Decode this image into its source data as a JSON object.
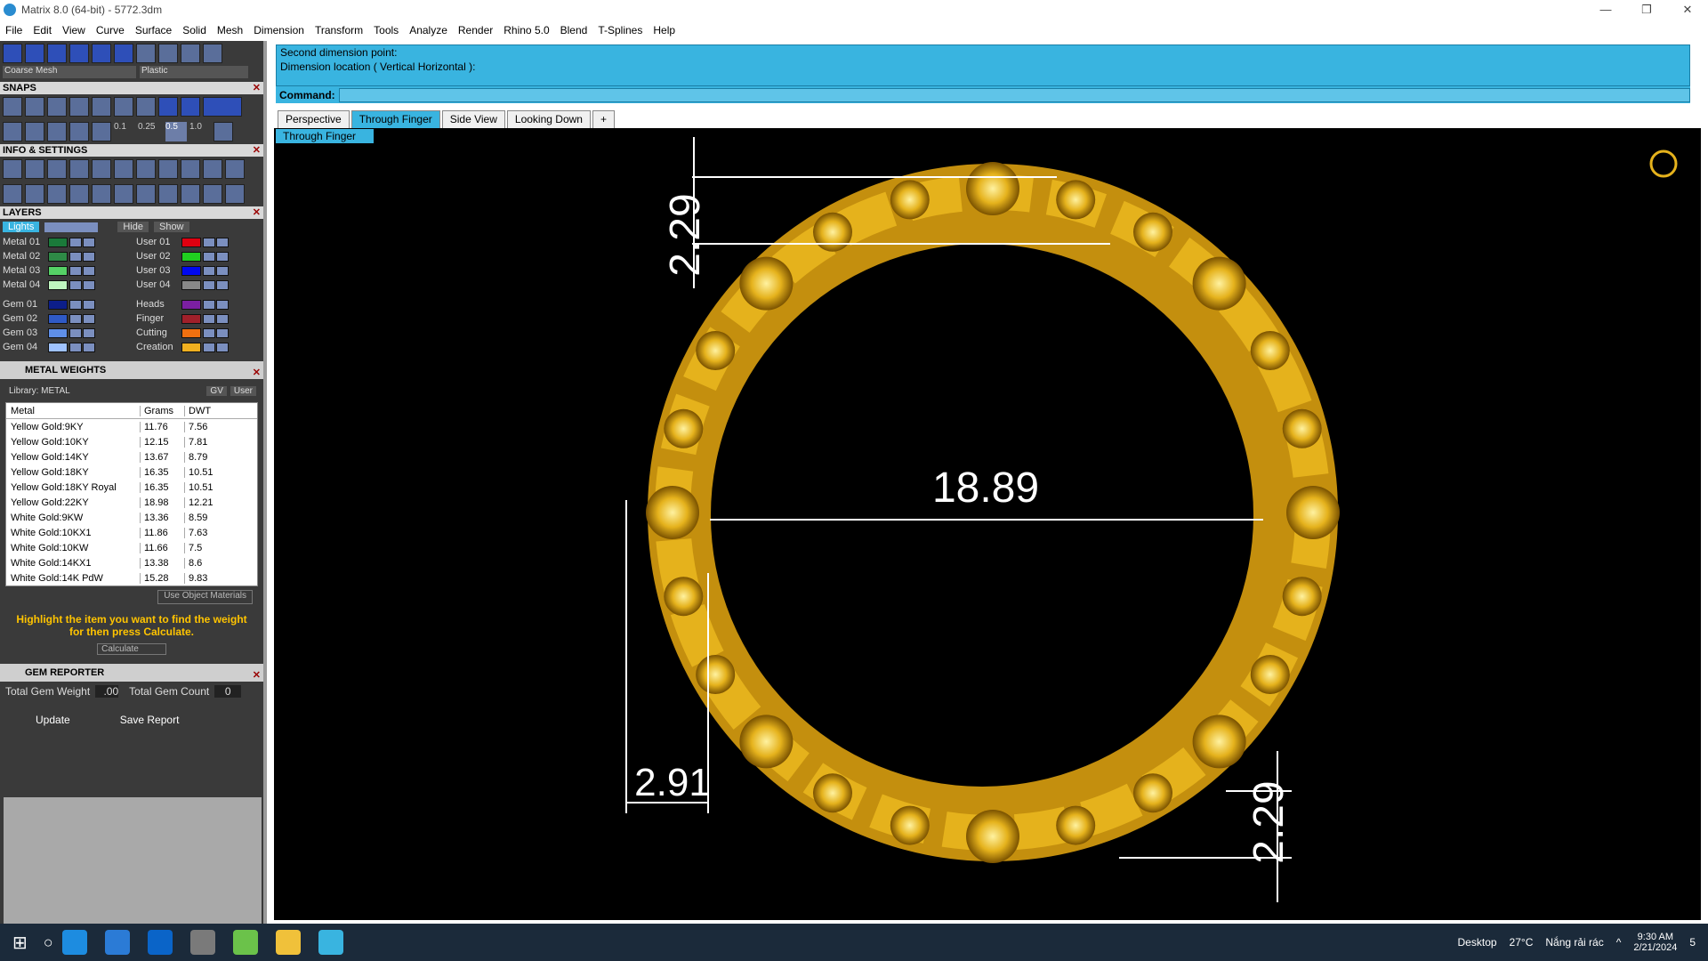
{
  "window": {
    "title": "Matrix 8.0 (64-bit) - 5772.3dm",
    "minimize": "—",
    "maximize": "❐",
    "close": "✕"
  },
  "menubar": [
    "File",
    "Edit",
    "View",
    "Curve",
    "Surface",
    "Solid",
    "Mesh",
    "Dimension",
    "Transform",
    "Tools",
    "Analyze",
    "Render",
    "Rhino 5.0",
    "Blend",
    "T-Splines",
    "Help"
  ],
  "leftpanel": {
    "mesh_dropdown": "Coarse Mesh",
    "material_dropdown": "Plastic",
    "snaps_title": "SNAPS",
    "snap_values": [
      "0.1",
      "0.25",
      "0.5",
      "1.0"
    ],
    "info_title": "INFO & SETTINGS",
    "layers_title": "LAYERS",
    "lights": "Lights",
    "hide": "Hide",
    "show": "Show",
    "layers_left": [
      "Metal 01",
      "Metal 02",
      "Metal 03",
      "Metal 04",
      "Gem 01",
      "Gem 02",
      "Gem 03",
      "Gem 04"
    ],
    "layers_left_colors": [
      "#1a7a3a",
      "#2e8a46",
      "#55d166",
      "#bff5bf",
      "#0c1e8a",
      "#2f5ac6",
      "#5f8fe8",
      "#9fc2ff"
    ],
    "layers_right": [
      "User 01",
      "User 02",
      "User 03",
      "User 04",
      "Heads",
      "Finger",
      "Cutting",
      "Creation"
    ],
    "layers_right_colors": [
      "#e00010",
      "#20d020",
      "#0008f0",
      "#888888",
      "#7b1fa2",
      "#a0202a",
      "#f07010",
      "#f0b020"
    ],
    "metal_weights_title": "METAL WEIGHTS",
    "library_label": "Library: METAL",
    "gv_label": "GV",
    "user_label": "User",
    "table_headers": [
      "Metal",
      "Grams",
      "DWT"
    ],
    "table_rows": [
      [
        "Yellow Gold:9KY",
        "11.76",
        "7.56"
      ],
      [
        "Yellow Gold:10KY",
        "12.15",
        "7.81"
      ],
      [
        "Yellow Gold:14KY",
        "13.67",
        "8.79"
      ],
      [
        "Yellow Gold:18KY",
        "16.35",
        "10.51"
      ],
      [
        "Yellow Gold:18KY Royal",
        "16.35",
        "10.51"
      ],
      [
        "Yellow Gold:22KY",
        "18.98",
        "12.21"
      ],
      [
        "White Gold:9KW",
        "13.36",
        "8.59"
      ],
      [
        "White Gold:10KX1",
        "11.86",
        "7.63"
      ],
      [
        "White Gold:10KW",
        "11.66",
        "7.5"
      ],
      [
        "White Gold:14KX1",
        "13.38",
        "8.6"
      ],
      [
        "White Gold:14K PdW",
        "15.28",
        "9.83"
      ]
    ],
    "use_object_materials": "Use Object Materials",
    "highlight_text": "Highlight the item you want to find the weight for then press Calculate.",
    "calculate": "Calculate",
    "gem_reporter_title": "GEM REPORTER",
    "total_gem_weight_label": "Total Gem Weight",
    "total_gem_weight_value": ".00",
    "total_gem_count_label": "Total Gem Count",
    "total_gem_count_value": "0",
    "update": "Update",
    "save_report": "Save Report"
  },
  "command": {
    "line1": "Second dimension point:",
    "line2": "Dimension location ( Vertical  Horizontal ):",
    "label": "Command:"
  },
  "tabs": [
    "Perspective",
    "Through Finger",
    "Side View",
    "Looking Down"
  ],
  "tab_add": "+",
  "active_tab": "Through Finger",
  "view_label": "Through Finger",
  "dimensions": {
    "top_thickness": "2.29",
    "inner_diameter": "18.89",
    "bottom_left_width": "2.91",
    "bottom_right_thickness": "2.29"
  },
  "taskbar": {
    "desktop": "Desktop",
    "temperature": "27°C",
    "weather": "Nắng rải rác",
    "time": "9:30 AM",
    "date": "2/21/2024",
    "notification_count": "5"
  },
  "colors": {
    "accent": "#39b4e0",
    "gold": "#e5b21c",
    "viewport_bg": "#000000"
  }
}
